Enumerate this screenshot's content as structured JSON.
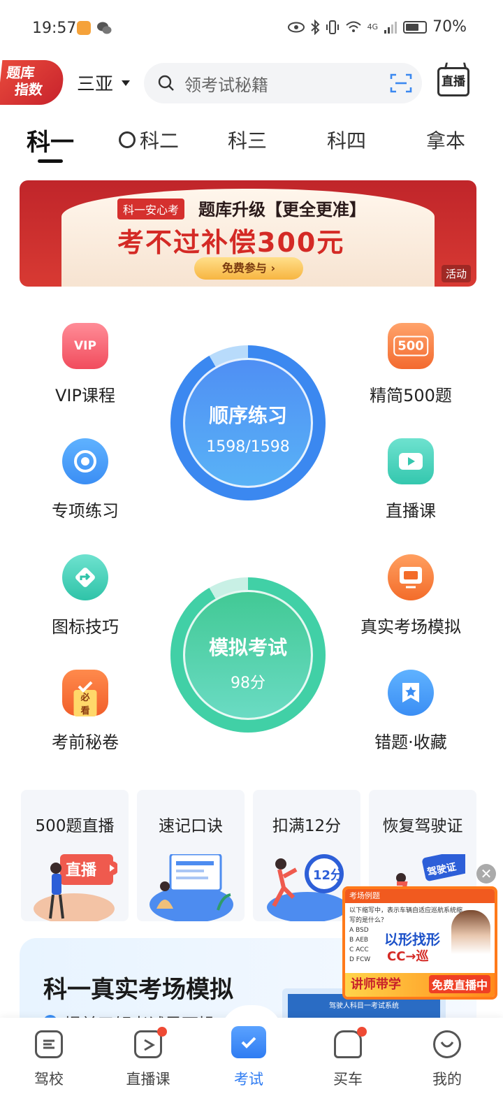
{
  "status_bar": {
    "time": "19:57",
    "network": "4G",
    "battery": "70%",
    "battery_level": 0.7
  },
  "header": {
    "logo_line1": "题库",
    "logo_line2": "指数",
    "city": "三亚",
    "search_placeholder": "领考试秘籍",
    "live_label": "直播"
  },
  "tabs": [
    {
      "label": "科一",
      "active": true
    },
    {
      "label": "科二",
      "active": false
    },
    {
      "label": "科三",
      "active": false
    },
    {
      "label": "科四",
      "active": false
    },
    {
      "label": "拿本",
      "active": false
    }
  ],
  "banner": {
    "tag": "科一安心考",
    "title": "题库升级【更全更准】",
    "headline": "考不过补偿300元",
    "cta": "免费参与",
    "badge": "活动"
  },
  "functions": {
    "vip": {
      "label": "VIP课程",
      "icon": "vip-icon",
      "icon_text": "VIP"
    },
    "simplified500": {
      "label": "精简500题",
      "icon": "500-icon",
      "icon_text": "500"
    },
    "special": {
      "label": "专项练习",
      "icon": "target-icon"
    },
    "live_course": {
      "label": "直播课",
      "icon": "video-icon"
    },
    "sign_tips": {
      "label": "图标技巧",
      "icon": "road-sign-icon"
    },
    "real_exam": {
      "label": "真实考场模拟",
      "icon": "monitor-icon"
    },
    "pre_exam": {
      "label": "考前秘卷",
      "icon": "paper-icon",
      "icon_text": "必看"
    },
    "mistakes": {
      "label": "错题·收藏",
      "icon": "star-bookmark-icon"
    }
  },
  "practice": {
    "sequential_title": "顺序练习",
    "sequential_progress": "1598/1598",
    "mock_title": "模拟考试",
    "mock_score": "98分"
  },
  "cards": [
    {
      "title": "500题直播",
      "art_text": "直播"
    },
    {
      "title": "速记口诀",
      "art_text": ""
    },
    {
      "title": "扣满12分",
      "art_text": "12分"
    },
    {
      "title": "恢复驾驶证",
      "art_text": "驾驶证"
    }
  ],
  "exam_section": {
    "title": "科一真实考场模拟",
    "subtitle": "提前了解考试界面操",
    "screen_text": "驾驶人科目一考试系统"
  },
  "promo": {
    "top_text": "考场例题",
    "question": "以下缩写中，表示车辆自适应巡航系统缩写的是什么？",
    "options": [
      "A BSD",
      "B AEB",
      "C ACC",
      "D FCW"
    ],
    "big_text": "以形找形",
    "cc_text": "CC→巡",
    "teach_text": "讲师带学",
    "live_text": "免费直播中"
  },
  "bottom_nav": [
    {
      "label": "驾校",
      "icon": "school-icon",
      "badge": false
    },
    {
      "label": "直播课",
      "icon": "tv-icon",
      "badge": true
    },
    {
      "label": "考试",
      "icon": "exam-check-icon",
      "badge": false,
      "active": true
    },
    {
      "label": "买车",
      "icon": "car-icon",
      "badge": true
    },
    {
      "label": "我的",
      "icon": "profile-smile-icon",
      "badge": false
    }
  ],
  "colors": {
    "accent_blue": "#2f7cf2",
    "brand_red": "#d42a25",
    "mock_green": "#42c995"
  }
}
